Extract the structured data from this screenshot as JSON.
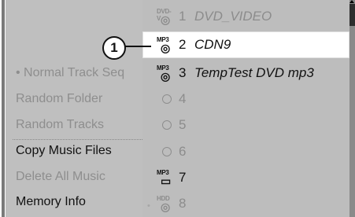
{
  "left_menu": {
    "items": [
      {
        "label": "• Normal Track Seq",
        "state": "dim"
      },
      {
        "label": "Random Folder",
        "state": "dim"
      },
      {
        "label": "Random Tracks",
        "state": "dim"
      },
      {
        "label": "Copy Music Files",
        "state": "bright"
      },
      {
        "label": "Delete All Music",
        "state": "dim"
      },
      {
        "label": "Memory Info",
        "state": "bright"
      }
    ]
  },
  "disc_list": {
    "items": [
      {
        "icon": "dvd-video-icon",
        "icon_label": "DVD-V",
        "number": "1",
        "title": "DVD_VIDEO",
        "state": "dim"
      },
      {
        "icon": "mp3-disc-icon",
        "icon_label": "MP3",
        "number": "2",
        "title": "CDN9",
        "state": "selected"
      },
      {
        "icon": "mp3-disc-icon",
        "icon_label": "MP3",
        "number": "3",
        "title": "TempTest DVD mp3",
        "state": "normal"
      },
      {
        "icon": "empty-slot-icon",
        "icon_label": "",
        "number": "4",
        "title": "",
        "state": "dim"
      },
      {
        "icon": "empty-slot-icon",
        "icon_label": "",
        "number": "5",
        "title": "",
        "state": "dim"
      },
      {
        "icon": "empty-slot-icon",
        "icon_label": "",
        "number": "6",
        "title": "",
        "state": "dim"
      },
      {
        "icon": "mp3-usb-icon",
        "icon_label": "MP3",
        "number": "7",
        "title": "",
        "state": "normal"
      },
      {
        "icon": "hdd-icon",
        "icon_label": "HDD",
        "number": "8",
        "title": "",
        "state": "dim"
      }
    ]
  },
  "callout": {
    "number": "1"
  },
  "colors": {
    "left_panel": "#bfbfbf",
    "right_panel": "#bdbdbd",
    "selected_row": "#ffffff",
    "dim_text": "#8c8c8c"
  }
}
